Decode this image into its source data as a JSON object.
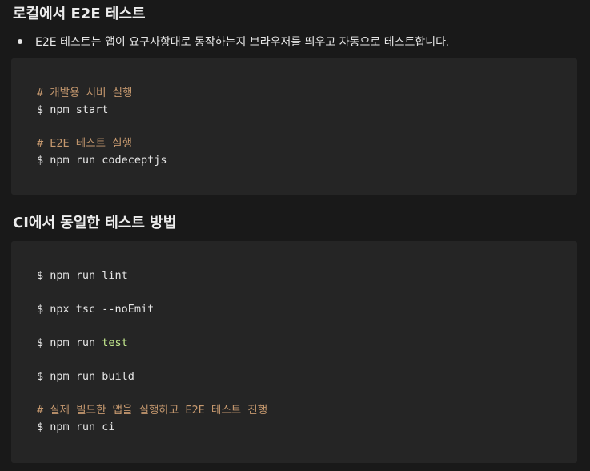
{
  "section1": {
    "heading": "로컬에서 E2E 테스트",
    "bullet": "E2E 테스트는 앱이 요구사항대로 동작하는지 브라우저를 띄우고 자동으로 테스트합니다.",
    "code": {
      "comment_dev": "# 개발용 서버 실행",
      "cmd_start": "$ npm start",
      "comment_e2e": "# E2E 테스트 실행",
      "cmd_codecept": "$ npm run codeceptjs"
    }
  },
  "section2": {
    "heading": "CI에서 동일한 테스트 방법",
    "code": {
      "cmd_lint": "$ npm run lint",
      "cmd_tsc": "$ npx tsc --noEmit",
      "cmd_test_prefix": "$ npm run ",
      "cmd_test_keyword": "test",
      "cmd_build": "$ npm run build",
      "comment_ci": "# 실제 빌드한 앱을 실행하고 E2E 테스트 진행",
      "cmd_ci": "$ npm run ci"
    }
  },
  "colors": {
    "background": "#191919",
    "code_background": "#252525",
    "comment": "#c5986e",
    "keyword_test": "#c3e88d",
    "text": "#e6e6e6"
  }
}
